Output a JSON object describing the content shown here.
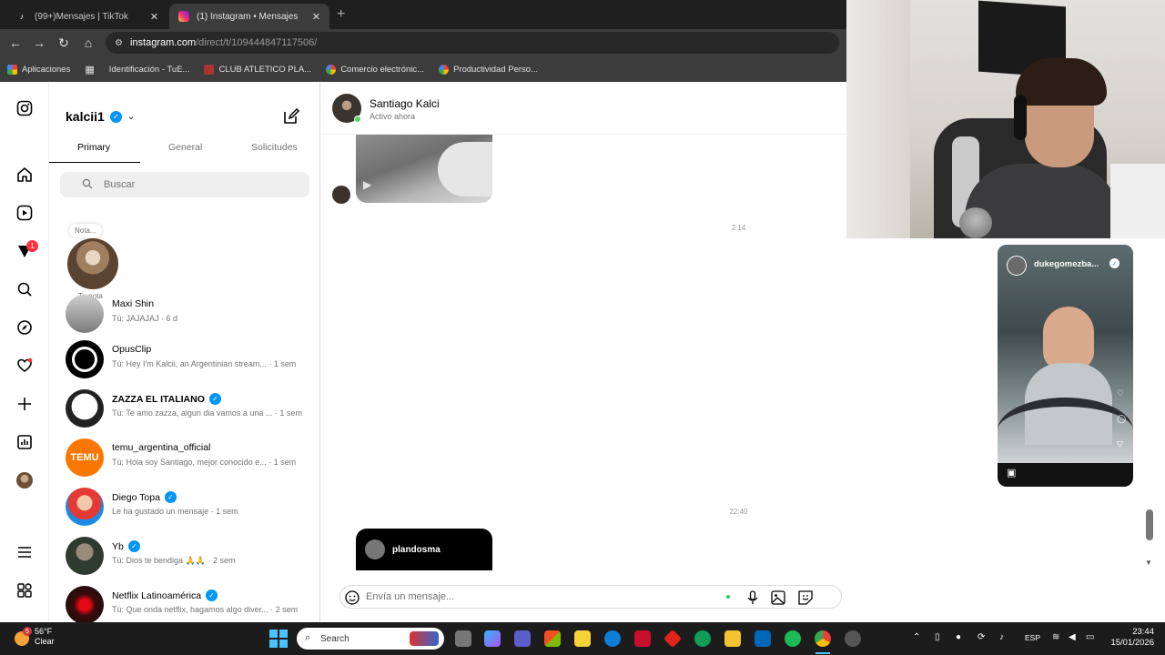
{
  "browser": {
    "tabs": [
      {
        "title": "(99+)Mensajes | TikTok",
        "active": false
      },
      {
        "title": "(1) Instagram • Mensajes",
        "active": true
      }
    ],
    "url_host": "instagram.com",
    "url_path": "/direct/t/109444847117506/",
    "bookmarks": [
      {
        "label": "Aplicaciones"
      },
      {
        "label": "Identificación - TuE..."
      },
      {
        "label": "CLUB ATLETICO PLA..."
      },
      {
        "label": "Comercio electrónic..."
      },
      {
        "label": "Productividad Perso..."
      }
    ]
  },
  "rail": {
    "notification_count": "1",
    "icons": [
      "instagram-logo-icon",
      "home-icon",
      "reels-icon",
      "messenger-icon",
      "search-icon",
      "explore-icon",
      "heart-icon",
      "create-icon",
      "dashboard-icon",
      "profile-icon",
      "menu-icon",
      "meta-apps-icon"
    ]
  },
  "inbox": {
    "username": "kalcii1",
    "tabs": [
      "Primary",
      "General",
      "Solicitudes"
    ],
    "selected_tab": "Primary",
    "search_placeholder": "Buscar",
    "note_bubble": "Nota...",
    "note_label": "Tu nota",
    "conversations": [
      {
        "name": "Maxi Shin",
        "last": "Tú: JAJAJAJ · 6 d",
        "verified": false,
        "bold": false
      },
      {
        "name": "OpusClip",
        "last": "Tú: Hey I'm Kalcii, an Argentinian stream... · 1 sem",
        "verified": false,
        "bold": false
      },
      {
        "name": "ZAZZA EL ITALIANO",
        "last": "Tú: Te amo zazza, algun dia vamos a una ... · 1 sem",
        "verified": true,
        "bold": true
      },
      {
        "name": "temu_argentina_official",
        "last": "Tú: Hola soy Santiago, mejor conocido e... · 1 sem",
        "verified": false,
        "bold": false
      },
      {
        "name": "Diego Topa",
        "last": "Le ha gustado un mensaje · 1 sem",
        "verified": true,
        "bold": false
      },
      {
        "name": "Yb",
        "last": "Tú: Dios te bendiga 🙏🙏 · 2 sem",
        "verified": true,
        "bold": false
      },
      {
        "name": "Netflix Latinoamérica",
        "last": "Tú: Que onda netflix, hagamos algo diver... · 2 sem",
        "verified": true,
        "bold": false
      }
    ]
  },
  "chat": {
    "contact_name": "Santiago Kalci",
    "status": "Activo ahora",
    "timestamps": [
      "2:14",
      "22:40"
    ],
    "shared_account": "plandosma",
    "composer_placeholder": "Envía un mensaje..."
  },
  "reel": {
    "username": "dukegomezba..."
  },
  "taskbar": {
    "temperature": "56°F",
    "weather": "Clear",
    "weather_badge": "5",
    "search_label": "Search",
    "language": "ESP",
    "time": "23:44",
    "date": "15/01/2026"
  },
  "colors": {
    "ig_blue": "#0095f6",
    "notif_red": "#ff3040",
    "online_green": "#4bd964",
    "browser_dark": "#3c3c3c"
  }
}
